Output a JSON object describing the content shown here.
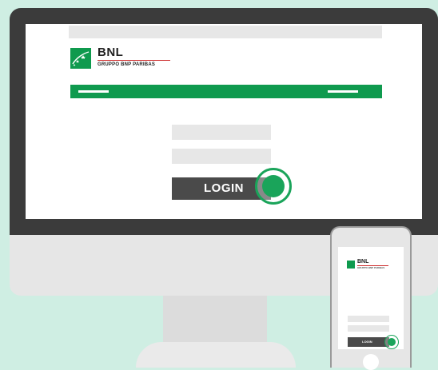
{
  "brand": {
    "name": "BNL",
    "tagline": "GRUPPO BNP PARIBAS",
    "logo_icon": "bnp-stars-icon"
  },
  "login": {
    "button_label": "LOGIN",
    "username_placeholder": "",
    "password_placeholder": ""
  },
  "colors": {
    "background": "#cfeee3",
    "brand_green": "#0f9a4e",
    "accent_red": "#cc2b2b",
    "button_dark": "#4a4a4a",
    "monitor_frame": "#3b3b3b"
  },
  "icons": {
    "touch_indicator": "touch-indicator-icon",
    "home_button": "home-button-icon"
  }
}
